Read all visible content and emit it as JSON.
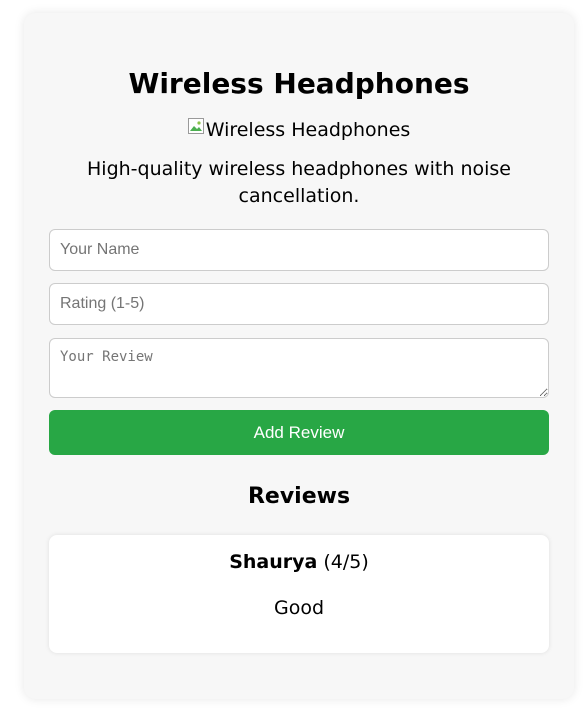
{
  "product": {
    "title": "Wireless Headphones",
    "image_alt": "Wireless Headphones",
    "description": "High-quality wireless headphones with noise cancellation."
  },
  "form": {
    "name_placeholder": "Your Name",
    "rating_placeholder": "Rating (1-5)",
    "review_placeholder": "Your Review",
    "submit_label": "Add Review"
  },
  "reviews": {
    "heading": "Reviews",
    "items": [
      {
        "author": "Shaurya",
        "rating": "(4/5)",
        "text": "Good"
      }
    ]
  },
  "colors": {
    "card_background": "#f7f7f7",
    "button": "#28a745",
    "button_text": "#ffffff"
  }
}
